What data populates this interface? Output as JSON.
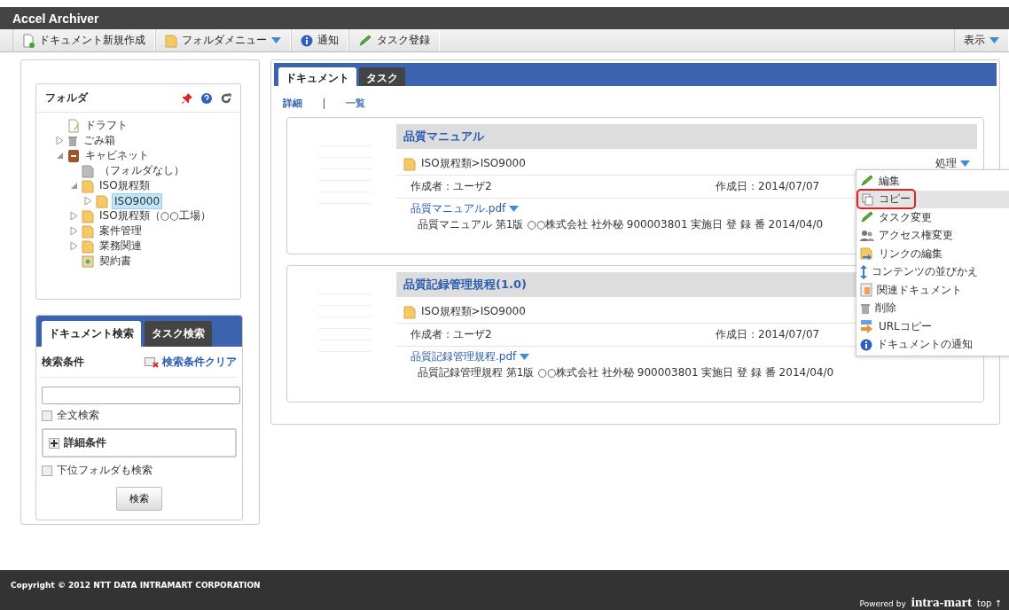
{
  "app": {
    "title": "Accel Archiver"
  },
  "toolbar": {
    "items": [
      {
        "label": "ドキュメント新規作成",
        "kind": "new-doc",
        "dropdown": false
      },
      {
        "label": "フォルダメニュー",
        "kind": "folder",
        "dropdown": true
      },
      {
        "label": "通知",
        "kind": "info",
        "dropdown": false
      },
      {
        "label": "タスク登録",
        "kind": "pencil",
        "dropdown": false
      }
    ],
    "view_menu": "表示"
  },
  "folder_panel": {
    "title": "フォルダ",
    "tree": [
      {
        "label": "ドラフト",
        "kind": "draft",
        "has_toggle": false,
        "selected": false
      },
      {
        "label": "ごみ箱",
        "kind": "trash",
        "has_toggle": true,
        "expanded": false,
        "selected": false
      },
      {
        "label": "キャビネット",
        "kind": "cabinet",
        "has_toggle": true,
        "expanded": true,
        "selected": false,
        "children": [
          {
            "label": "（フォルダなし）",
            "kind": "grey-folder",
            "has_toggle": false,
            "selected": false
          },
          {
            "label": "ISO規程類",
            "kind": "folder",
            "has_toggle": true,
            "expanded": true,
            "selected": false,
            "children": [
              {
                "label": "ISO9000",
                "kind": "folder",
                "has_toggle": true,
                "expanded": false,
                "selected": true
              }
            ]
          },
          {
            "label": "ISO規程類（○○工場）",
            "kind": "folder",
            "has_toggle": true,
            "expanded": false,
            "selected": false
          },
          {
            "label": "案件管理",
            "kind": "folder",
            "has_toggle": true,
            "expanded": false,
            "selected": false
          },
          {
            "label": "業務関連",
            "kind": "folder",
            "has_toggle": true,
            "expanded": false,
            "selected": false
          },
          {
            "label": "契約書",
            "kind": "contract",
            "has_toggle": false,
            "selected": false
          }
        ]
      }
    ]
  },
  "search_panel": {
    "tabs": [
      {
        "label": "ドキュメント検索",
        "selected": true
      },
      {
        "label": "タスク検索",
        "selected": false
      }
    ],
    "conditions_label": "検索条件",
    "clear_link": "検索条件クリア",
    "full_text": {
      "label": "全文検索",
      "checked": false
    },
    "details": {
      "label": "詳細条件",
      "expanded": false
    },
    "subfolders": {
      "label": "下位フォルダも検索",
      "checked": false
    },
    "search_button": "検索"
  },
  "main": {
    "tabs": [
      {
        "label": "ドキュメント",
        "selected": true
      },
      {
        "label": "タスク",
        "selected": false
      }
    ],
    "views": [
      {
        "label": "詳細",
        "selected": true
      },
      {
        "label": "一覧",
        "selected": false
      }
    ],
    "documents": [
      {
        "title": "品質マニュアル",
        "path": "ISO規程類>ISO9000",
        "author": "作成者：ユーザ2",
        "date": "作成日：2014/07/07",
        "file": "品質マニュアル.pdf",
        "description": "品質マニュアル 第1版 ○○株式会社 社外秘 900003801 実施日 登 録 番 2014/04/0",
        "action": "処理"
      },
      {
        "title": "品質記録管理規程(1.0)",
        "path": "ISO規程類>ISO9000",
        "author": "作成者：ユーザ2",
        "date": "作成日：2014/07/07",
        "file": "品質記録管理規程.pdf",
        "description": "品質記録管理規程 第1版 ○○株式会社 社外秘 900003801 実施日 登 録 番 2014/04/0"
      }
    ],
    "action_menu": [
      {
        "label": "編集",
        "kind": "pencil",
        "selected": false
      },
      {
        "label": "コピー",
        "kind": "copy",
        "selected": true
      },
      {
        "label": "タスク変更",
        "kind": "pencil",
        "selected": false
      },
      {
        "label": "アクセス権変更",
        "kind": "users",
        "selected": false
      },
      {
        "label": "リンクの編集",
        "kind": "link",
        "selected": false
      },
      {
        "label": "コンテンツの並びかえ",
        "kind": "sort",
        "selected": false
      },
      {
        "label": "関連ドキュメント",
        "kind": "related",
        "selected": false
      },
      {
        "label": "削除",
        "kind": "trash",
        "selected": false
      },
      {
        "label": "URLコピー",
        "kind": "url",
        "selected": false
      },
      {
        "label": "ドキュメントの通知",
        "kind": "info",
        "selected": false
      }
    ]
  },
  "footer": {
    "copyright": "Copyright © 2012 NTT DATA INTRAMART CORPORATION",
    "powered_by": "Powered by",
    "logo": "intra-mart",
    "top_link": "top ↑"
  }
}
